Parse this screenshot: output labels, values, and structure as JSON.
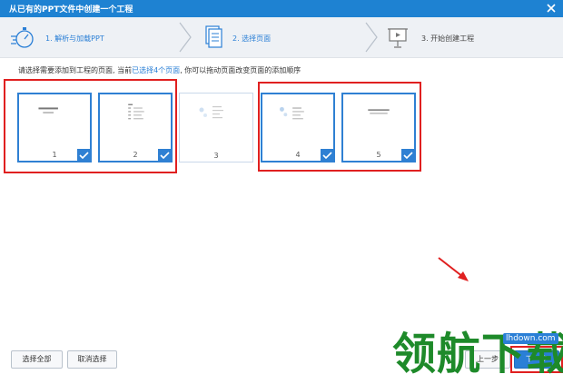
{
  "window": {
    "title": "从已有的PPT文件中创建一个工程"
  },
  "steps": [
    {
      "label": "1. 解析与加载PPT",
      "state": "done",
      "icon": "stopwatch-icon"
    },
    {
      "label": "2. 选择页面",
      "state": "active",
      "icon": "document-pages-icon"
    },
    {
      "label": "3. 开始创建工程",
      "state": "pending",
      "icon": "projector-icon"
    }
  ],
  "instructions": {
    "prefix": "请选择需要添加到工程的页面, 当前",
    "highlight": "已选择4个页面",
    "suffix": ", 你可以拖动页面改变页面的添加顺序"
  },
  "pages": [
    {
      "number": "1",
      "selected": true
    },
    {
      "number": "2",
      "selected": true
    },
    {
      "number": "3",
      "selected": false
    },
    {
      "number": "4",
      "selected": true
    },
    {
      "number": "5",
      "selected": true
    }
  ],
  "buttons": {
    "select_all": "选择全部",
    "deselect": "取消选择",
    "prev": "上一步",
    "next": "下一步"
  },
  "watermark": {
    "text": "领航下载",
    "url": "lhdown.com"
  },
  "colors": {
    "accent": "#2a7fd6",
    "titlebar": "#1e82d2",
    "highlight_box": "#e02020",
    "watermark": "#1e8a2a"
  }
}
